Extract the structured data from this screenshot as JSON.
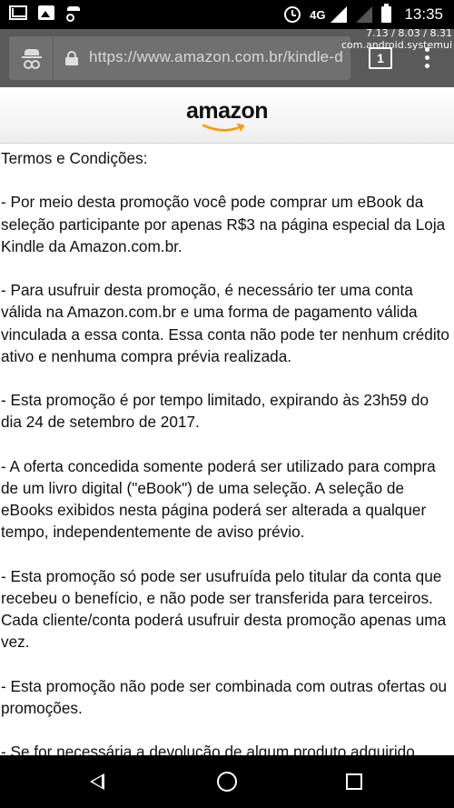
{
  "status_bar": {
    "network": "4G",
    "time": "13:35",
    "icons": [
      "gmail-icon",
      "image-icon",
      "incognito-icon",
      "alarm-icon",
      "signal-icon",
      "signal-empty-icon",
      "battery-icon"
    ]
  },
  "overlay": {
    "line1": "7.13 / 8.03 / 8.31",
    "line2": "com.android.systemui"
  },
  "browser": {
    "url": "https://www.amazon.com.br/kindle-d",
    "tab_count": "1"
  },
  "header": {
    "logo_text": "amazon",
    "smile_color": "#ff9900"
  },
  "content": {
    "paragraphs": [
      "Termos e Condições:",
      "- Por meio desta promoção você pode comprar um eBook da seleção participante por apenas R$3 na página especial da Loja Kindle da Amazon.com.br.",
      "- Para usufruir desta promoção, é necessário ter uma conta válida na Amazon.com.br e uma forma de pagamento válida vinculada a essa conta. Essa conta não pode ter nenhum crédito ativo e nenhuma compra prévia realizada.",
      "- Esta promoção é por tempo limitado, expirando às 23h59 do dia 24 de setembro de 2017.",
      "- A oferta concedida somente poderá ser utilizado para compra de um livro digital (\"eBook\") de uma seleção. A seleção de eBooks exibidos nesta página poderá ser alterada a qualquer tempo, independentemente de aviso prévio.",
      "- Esta promoção só pode ser usufruída pelo titular da conta que recebeu o benefício, e não pode ser transferida para terceiros. Cada cliente/conta poderá usufruir desta promoção apenas uma vez.",
      "- Esta promoção não pode ser combinada com outras ofertas ou promoções.",
      "- Se for necessária a devolução de algum produto adquirido"
    ]
  }
}
